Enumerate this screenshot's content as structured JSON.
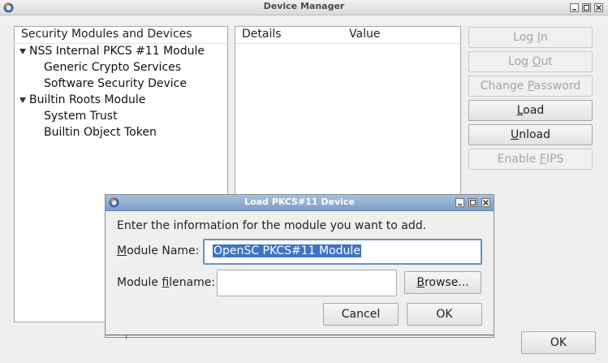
{
  "window": {
    "title": "Device Manager",
    "icon": "firefox-icon",
    "controls": [
      "minimize-icon",
      "maximize-icon",
      "close-icon"
    ]
  },
  "tree": {
    "header": "Security Modules and Devices",
    "items": [
      {
        "label": "NSS Internal PKCS #11 Module",
        "expanded": true,
        "level": 0
      },
      {
        "label": "Generic Crypto Services",
        "level": 1
      },
      {
        "label": "Software Security Device",
        "level": 1
      },
      {
        "label": "Builtin Roots Module",
        "expanded": true,
        "level": 0
      },
      {
        "label": "System Trust",
        "level": 1
      },
      {
        "label": "Builtin Object Token",
        "level": 1
      }
    ]
  },
  "details": {
    "col_details": "Details",
    "col_value": "Value"
  },
  "buttons": {
    "login": {
      "pre": "Log ",
      "u": "I",
      "post": "n",
      "enabled": false
    },
    "logout": {
      "pre": "Log ",
      "u": "O",
      "post": "ut",
      "enabled": false
    },
    "change_password": {
      "pre": "Change ",
      "u": "P",
      "post": "assword",
      "enabled": false
    },
    "load": {
      "pre": "",
      "u": "L",
      "post": "oad",
      "enabled": true
    },
    "unload": {
      "pre": "",
      "u": "U",
      "post": "nload",
      "enabled": true
    },
    "enable_fips": {
      "pre": "Enable ",
      "u": "F",
      "post": "IPS",
      "enabled": false
    },
    "ok": "OK"
  },
  "dialog": {
    "title": "Load PKCS#11 Device",
    "instruction": "Enter the information for the module you want to add.",
    "module_name": {
      "pre": "",
      "u": "M",
      "post": "odule Name:",
      "value": "OpenSC PKCS#11 Module"
    },
    "module_filename": {
      "pre": "Module ",
      "u": "f",
      "post": "ilename:",
      "value": ""
    },
    "browse": {
      "pre": "",
      "u": "B",
      "post": "rowse...",
      "enabled": true
    },
    "cancel": "Cancel",
    "ok": "OK"
  },
  "colors": {
    "selection": "#3d74c4",
    "dialog_title": "#8aa8cf"
  }
}
